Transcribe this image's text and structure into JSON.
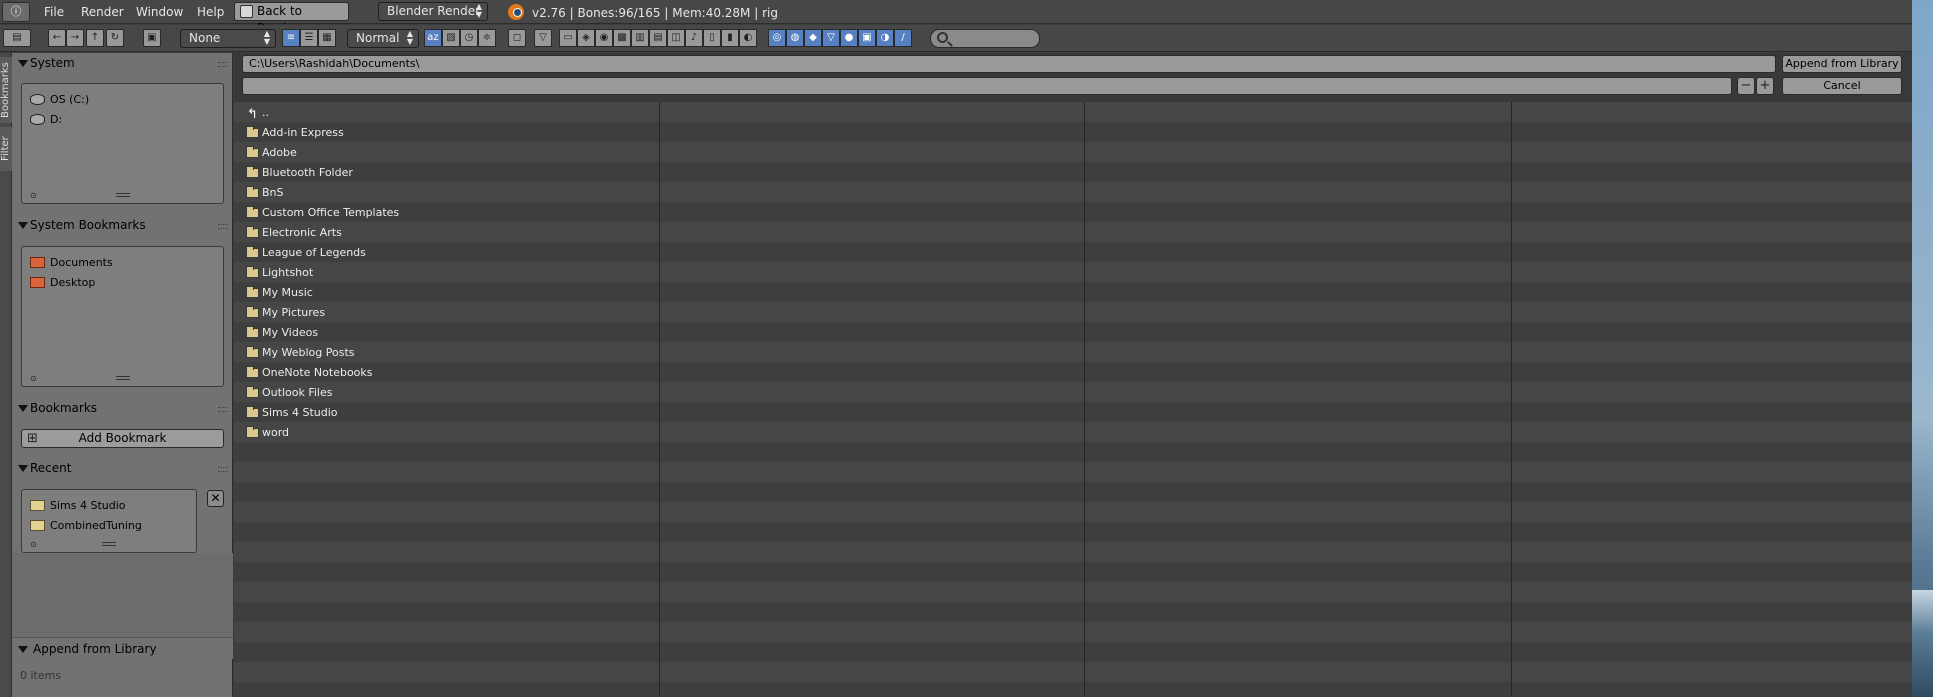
{
  "topbar": {
    "editor_icon": "info-icon",
    "menus": [
      "File",
      "Render",
      "Window",
      "Help"
    ],
    "back_button": "Back to Previous",
    "render_engine": "Blender Render",
    "status": "v2.76 | Bones:96/165  | Mem:40.28M | rig"
  },
  "toolbar": {
    "display_mode": "None",
    "sort_mode": "Normal",
    "search_placeholder": ""
  },
  "vertical_tabs": [
    "Bookmarks",
    "Filter"
  ],
  "sidebar": {
    "system": {
      "title": "System",
      "items": [
        "OS (C:)",
        "D:"
      ]
    },
    "system_bookmarks": {
      "title": "System Bookmarks",
      "items": [
        "Documents",
        "Desktop"
      ]
    },
    "bookmarks": {
      "title": "Bookmarks",
      "add_label": "Add Bookmark"
    },
    "recent": {
      "title": "Recent",
      "items": [
        "Sims 4 Studio",
        "CombinedTuning"
      ]
    },
    "append": {
      "title": "Append from Library",
      "count": "0 items"
    }
  },
  "main": {
    "path": "C:\\Users\\Rashidah\\Documents\\",
    "filename": "",
    "append_button": "Append from Library",
    "cancel_button": "Cancel",
    "parent_dir": "..",
    "files": [
      "Add-in Express",
      "Adobe",
      "Bluetooth Folder",
      "BnS",
      "Custom Office Templates",
      "Electronic Arts",
      "League of Legends",
      "Lightshot",
      "My Music",
      "My Pictures",
      "My Videos",
      "My Weblog Posts",
      "OneNote Notebooks",
      "Outlook Files",
      "Sims 4 Studio",
      "word"
    ]
  }
}
